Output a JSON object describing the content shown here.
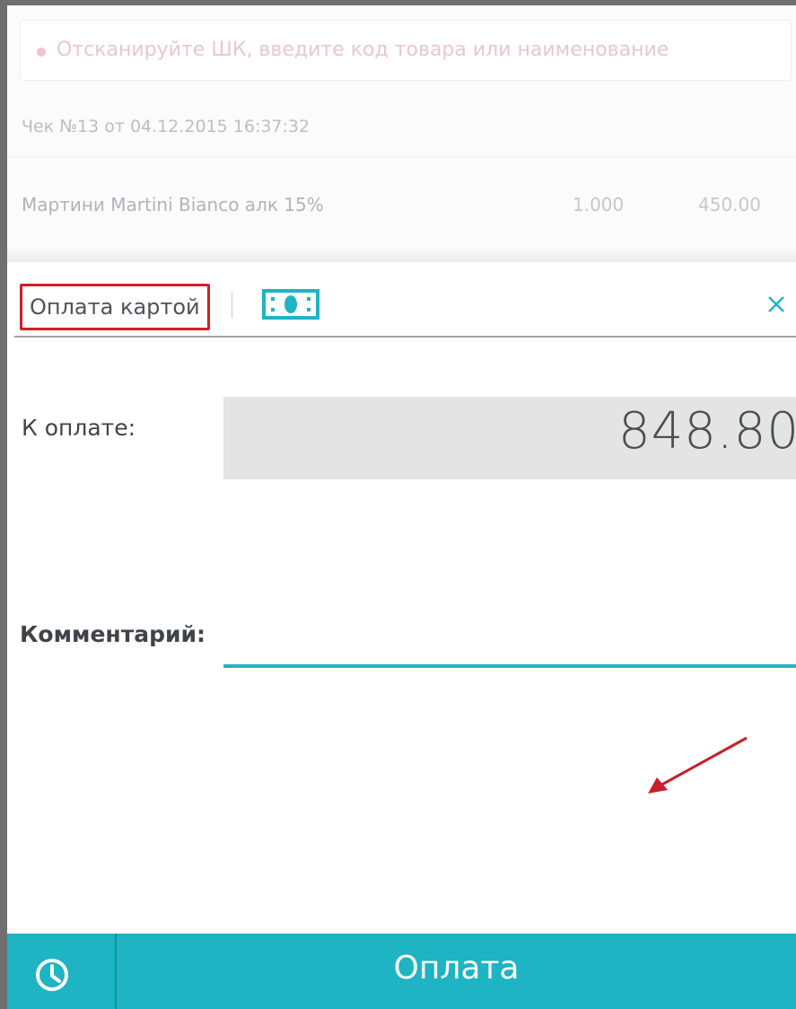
{
  "search": {
    "placeholder": "Отсканируйте ШК, введите код товара или наименование"
  },
  "receipt": {
    "title": "Чек №13 от 04.12.2015 16:37:32",
    "items": [
      {
        "name": "Мартини Martini Bianco алк 15%",
        "qty": "1.000",
        "price": "450.00"
      }
    ]
  },
  "payment": {
    "tabs": {
      "card_label": "Оплата картой",
      "cash_icon": "cash-banknote-icon"
    },
    "close_icon": "close-icon",
    "amount_label": "К оплате:",
    "amount_value": "848.80",
    "comment_label": "Комментарий:",
    "comment_value": ""
  },
  "bottom_bar": {
    "history_icon": "clock-icon",
    "pay_label": "Оплата"
  },
  "colors": {
    "accent": "#1eb4c4",
    "highlight_box": "#d11f27",
    "annotation_arrow": "#c8202a"
  }
}
